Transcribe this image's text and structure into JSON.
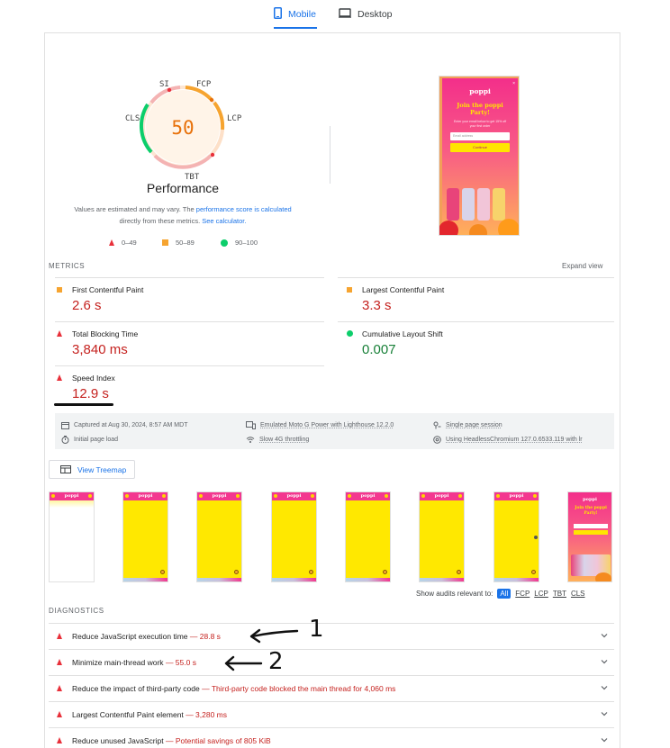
{
  "tabs": {
    "mobile": "Mobile",
    "desktop": "Desktop"
  },
  "gauge": {
    "score": "50",
    "labels": {
      "si": "SI",
      "fcp": "FCP",
      "lcp": "LCP",
      "tbt": "TBT",
      "cls": "CLS"
    },
    "title": "Performance",
    "note_pre": "Values are estimated and may vary. The ",
    "note_link1": "performance score is calculated",
    "note_mid": "directly from these metrics. ",
    "note_link2": "See calculator."
  },
  "legend": {
    "fail": "0–49",
    "average": "50–89",
    "pass": "90–100"
  },
  "screenshot": {
    "brand": "poppi",
    "headline": "Join the poppi Party!",
    "blurb": "Enter your email below to get 15% off your first order",
    "input_placeholder": "Email address",
    "cta": "Continue"
  },
  "metrics": {
    "heading": "METRICS",
    "expand": "Expand view",
    "fcp": {
      "label": "First Contentful Paint",
      "value": "2.6 s"
    },
    "lcp": {
      "label": "Largest Contentful Paint",
      "value": "3.3 s"
    },
    "tbt": {
      "label": "Total Blocking Time",
      "value": "3,840 ms"
    },
    "cls": {
      "label": "Cumulative Layout Shift",
      "value": "0.007"
    },
    "si": {
      "label": "Speed Index",
      "value": "12.9 s"
    }
  },
  "environment": {
    "captured": "Captured at Aug 30, 2024, 8:57 AM MDT",
    "device": "Emulated Moto G Power with Lighthouse 12.2.0",
    "session": "Single page session",
    "load": "Initial page load",
    "throttling": "Slow 4G throttling",
    "browser": "Using HeadlessChromium 127.0.6533.119 with lr"
  },
  "treemap": "View Treemap",
  "filmstrip": {
    "brand": "poppi",
    "final_headline": "Join the poppi Party!"
  },
  "audits_filter": {
    "label": "Show audits relevant to:",
    "all": "All",
    "fcp": "FCP",
    "lcp": "LCP",
    "tbt": "TBT",
    "cls": "CLS"
  },
  "diagnostics": {
    "heading": "DIAGNOSTICS",
    "rows": [
      {
        "title": "Reduce JavaScript execution time",
        "value": "— 28.8 s"
      },
      {
        "title": "Minimize main-thread work",
        "value": "— 55.0 s"
      },
      {
        "title": "Reduce the impact of third-party code",
        "value": "— Third-party code blocked the main thread for 4,060 ms"
      },
      {
        "title": "Largest Contentful Paint element",
        "value": "— 3,280 ms"
      },
      {
        "title": "Reduce unused JavaScript",
        "value": "— Potential savings of 805 KiB"
      }
    ]
  },
  "annotations": {
    "one": "1",
    "two": "2"
  },
  "colors": {
    "accent": "#1a73e8",
    "fail": "#e8303a",
    "average": "#f6a430",
    "pass": "#0cce6b",
    "value_red": "#c5221f",
    "value_green": "#188038"
  }
}
